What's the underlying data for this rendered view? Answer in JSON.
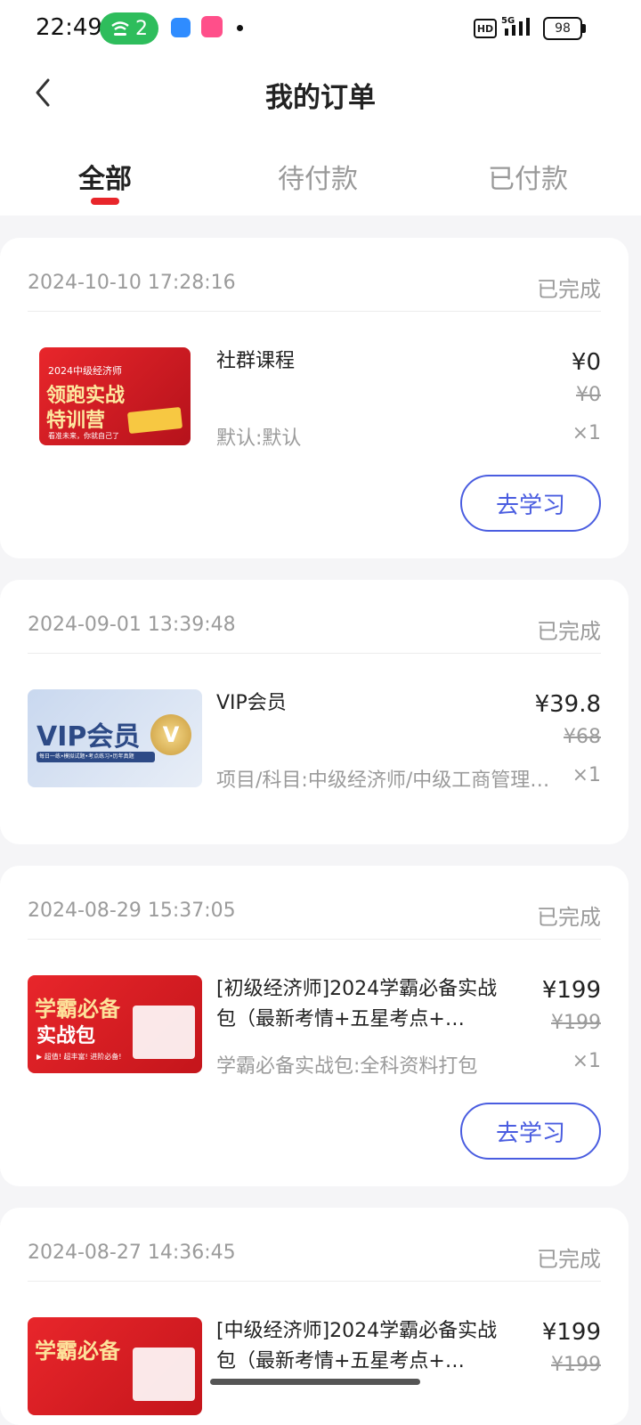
{
  "statusbar": {
    "time": "22:49",
    "wifi_count": "2",
    "hd": "HD",
    "battery": "98"
  },
  "header": {
    "title": "我的订单"
  },
  "tabs": [
    {
      "label": "全部",
      "active": true
    },
    {
      "label": "待付款",
      "active": false
    },
    {
      "label": "已付款",
      "active": false
    }
  ],
  "orders": [
    {
      "date": "2024-10-10 17:28:16",
      "status": "已完成",
      "name": "社群课程",
      "spec": "默认:默认",
      "price": "¥0",
      "orig_price": "¥0",
      "qty": "×1",
      "button": "去学习",
      "thumb": {
        "line1": "2024中级经济师",
        "line2": "领跑实战",
        "line3": "特训营",
        "tag": "看准未来，你就自己了"
      }
    },
    {
      "date": "2024-09-01 13:39:48",
      "status": "已完成",
      "name": "VIP会员",
      "spec": "项目/科目:中级经济师/中级工商管理…",
      "price": "¥39.8",
      "orig_price": "¥68",
      "qty": "×1",
      "thumb": {
        "title": "VIP会员",
        "sub": "每日一练•模拟试题•考点练习•历年真题",
        "badge": "V"
      }
    },
    {
      "date": "2024-08-29 15:37:05",
      "status": "已完成",
      "name": "[初级经济师]2024学霸必备实战包（最新考情+五星考点+…",
      "spec": "学霸必备实战包:全科资料打包",
      "price": "¥199",
      "orig_price": "¥199",
      "qty": "×1",
      "button": "去学习",
      "thumb": {
        "line1": "学霸必备",
        "line2": "实战包",
        "tag": "▶ 超值! 超丰富! 进阶必备!"
      }
    },
    {
      "date": "2024-08-27 14:36:45",
      "status": "已完成",
      "name": "[中级经济师]2024学霸必备实战包（最新考情+五星考点+…",
      "price": "¥199",
      "orig_price": "¥199",
      "thumb": {
        "line1": "学霸必备"
      }
    }
  ],
  "colors": {
    "accent": "#4a5de0",
    "tab_indicator": "#e8262b",
    "muted": "#9b9b9b",
    "background": "#f5f5f7"
  }
}
